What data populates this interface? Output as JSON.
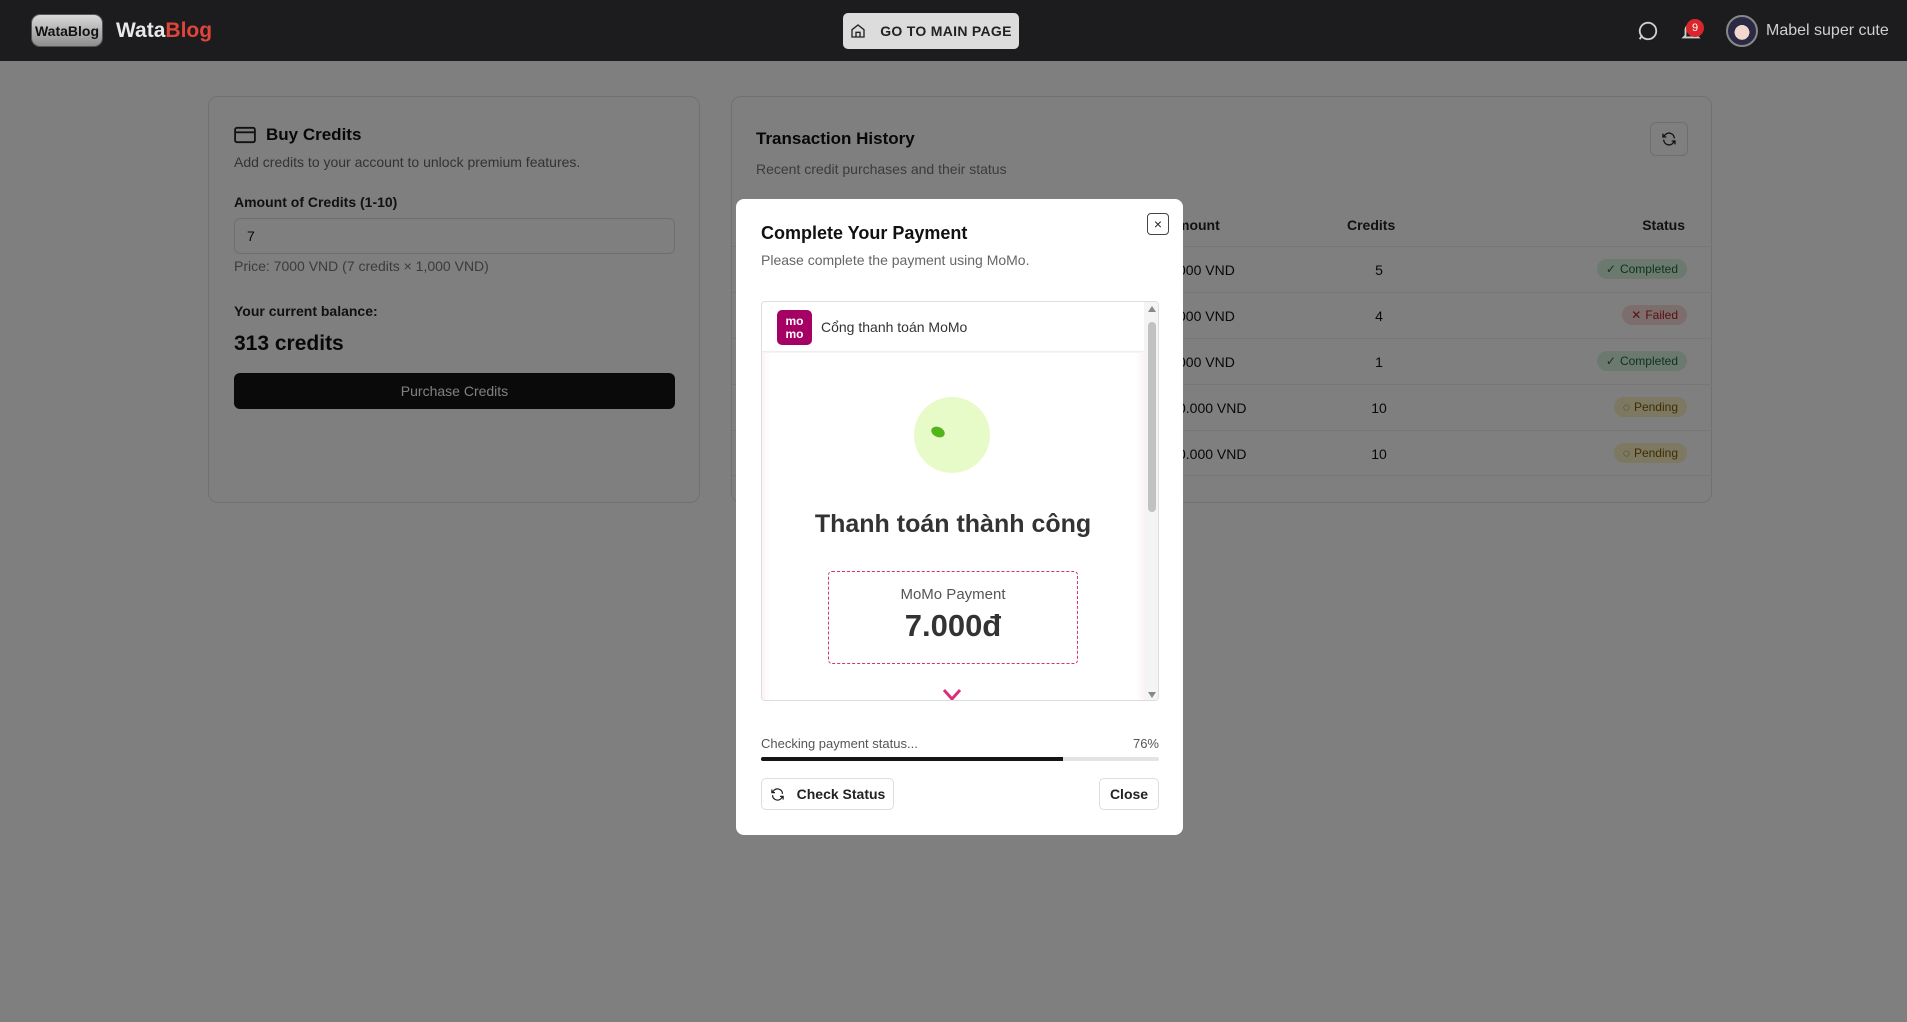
{
  "header": {
    "logo_badge": "WataBlog",
    "brand_part1": "Wata",
    "brand_part2": "Blog",
    "main_page_button": "GO TO MAIN PAGE",
    "notification_count": "9",
    "user_name": "Mabel super cute",
    "colors": {
      "background": "#1c1c1f",
      "brand_accent": "#e0443a",
      "badge": "#d9262c"
    }
  },
  "buy_credits": {
    "title": "Buy Credits",
    "subtitle": "Add credits to your account to unlock premium features.",
    "amount_label": "Amount of Credits (1-10)",
    "amount_value": "7",
    "price_text": "Price: 7000 VND (7 credits × 1,000 VND)",
    "balance_label": "Your current balance:",
    "balance_value": "313 credits",
    "purchase_button": "Purchase Credits"
  },
  "transactions": {
    "title": "Transaction History",
    "subtitle": "Recent credit purchases and their status",
    "columns": [
      "mount",
      "Credits",
      "Status"
    ],
    "rows": [
      {
        "amount": "000 VND",
        "credits": "5",
        "status": "Completed",
        "status_icon": "check-icon",
        "status_color": "#1a6b35"
      },
      {
        "amount": "000 VND",
        "credits": "4",
        "status": "Failed",
        "status_icon": "x-icon",
        "status_color": "#b02020"
      },
      {
        "amount": "000 VND",
        "credits": "1",
        "status": "Completed",
        "status_icon": "check-icon",
        "status_color": "#1a6b35"
      },
      {
        "amount": "0.000 VND",
        "credits": "10",
        "status": "Pending",
        "status_icon": "spinner-icon",
        "status_color": "#7a5a00"
      },
      {
        "amount": "0.000 VND",
        "credits": "10",
        "status": "Pending",
        "status_icon": "spinner-icon",
        "status_color": "#7a5a00"
      }
    ]
  },
  "modal": {
    "title": "Complete Your Payment",
    "subtitle": "Please complete the payment using MoMo.",
    "close_glyph": "×",
    "momo_logo_line1": "mo",
    "momo_logo_line2": "mo",
    "gateway_title": "Cổng thanh toán MoMo",
    "success_text": "Thanh toán thành công",
    "payment_label": "MoMo Payment",
    "payment_amount": "7.000đ",
    "status_text": "Checking payment status...",
    "progress_percent": "76%",
    "progress_value": 76,
    "check_button": "Check Status",
    "close_button": "Close",
    "colors": {
      "momo": "#a50064",
      "success_bg": "#e7fbc9",
      "success_dot": "#52b51c"
    }
  }
}
